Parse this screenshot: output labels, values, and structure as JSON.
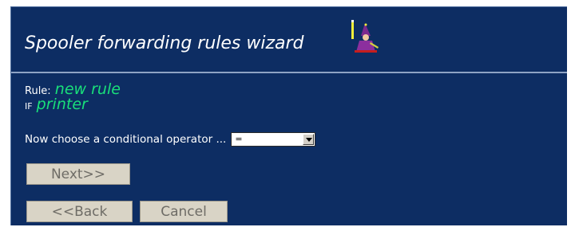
{
  "wizard": {
    "title": "Spooler forwarding rules wizard",
    "icon": "wizard-icon"
  },
  "rule": {
    "label": "Rule:",
    "name": "new rule",
    "if_label": "IF",
    "condition_field": "printer"
  },
  "operator": {
    "prompt": "Now choose a conditional operator ...",
    "selected_value": "="
  },
  "buttons": {
    "next_label": "Next>>",
    "back_label": "<<Back",
    "cancel_label": "Cancel"
  },
  "colors": {
    "panel_background": "#0d2d63",
    "highlight_text": "#19e07a",
    "button_face": "#d9d4c6"
  }
}
